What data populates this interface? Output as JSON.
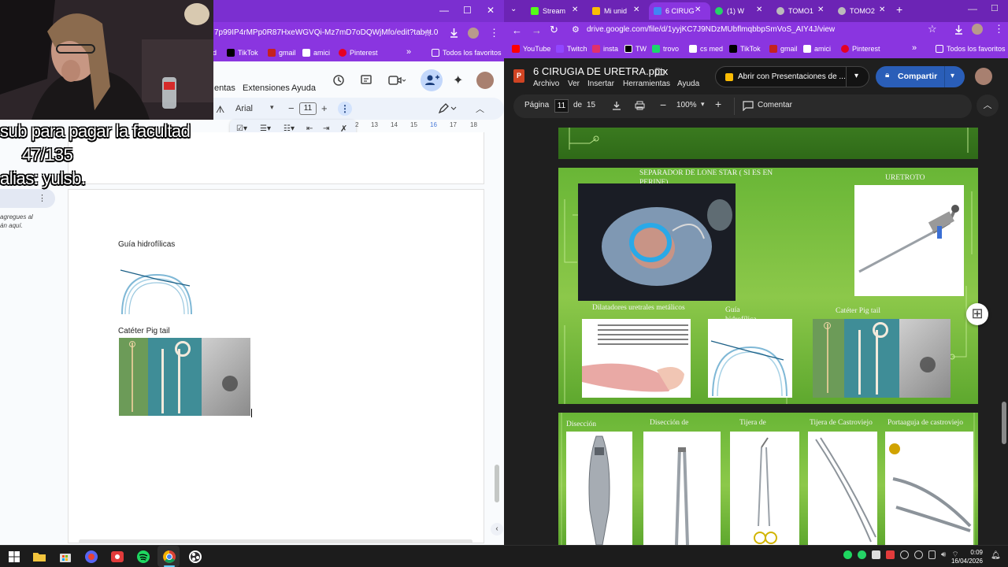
{
  "left_window": {
    "controls": {
      "minimize": "—",
      "maximize": "☐",
      "close": "✕"
    },
    "url": "7p99IP4rMPp0R87HxeWGVQi-Mz7mD7oDQWjMfo/edit?tab=t.0",
    "bookmarks": [
      {
        "label": "d",
        "color": "#ffffff"
      },
      {
        "label": "TikTok",
        "color": "#000000"
      },
      {
        "label": "gmail",
        "color": "#c5221f"
      },
      {
        "label": "amici",
        "color": "#ffffff"
      },
      {
        "label": "Pinterest",
        "color": "#e60023"
      }
    ],
    "more_bookmarks": "»",
    "all_bookmarks": "Todos los favoritos",
    "menu": {
      "item1": "entas",
      "item2": "Extensiones",
      "item3": "Ayuda"
    },
    "toolbar": {
      "font": "Arial",
      "font_size": "11",
      "minus": "−",
      "plus": "+"
    },
    "ruler": [
      "2",
      "13",
      "14",
      "15",
      "16",
      "17",
      "18"
    ],
    "outline_hint_line1": "agregues al",
    "outline_hint_line2": "án aquí.",
    "document": {
      "caption1": "Guía hidrofílicas",
      "caption2": "Catéter Pig tail"
    }
  },
  "overlay": {
    "line1": "sub para pagar la facultad",
    "line2": "47/135",
    "line3": "alias: yulsb."
  },
  "right_window": {
    "tabs": [
      {
        "label": "Stream",
        "color": "#53fc18"
      },
      {
        "label": "Mi unid",
        "color": "#fbbc04"
      },
      {
        "label": "6 CIRUG",
        "color": "#4285f4"
      },
      {
        "label": "(1) W",
        "color": "#25d366"
      },
      {
        "label": "TOMO1",
        "color": "#bbbbbb"
      },
      {
        "label": "TOMO2",
        "color": "#bbbbbb"
      }
    ],
    "new_tab": "+",
    "url": "drive.google.com/file/d/1yyjKC7J9NDzMUbflmqbbpSmVoS_AIY4J/view",
    "bookmarks": [
      {
        "label": "YouTube",
        "color": "#ff0000"
      },
      {
        "label": "Twitch",
        "color": "#9146ff"
      },
      {
        "label": "insta",
        "color": "#e1306c"
      },
      {
        "label": "TW",
        "color": "#000000"
      },
      {
        "label": "trovo",
        "color": "#1bd66c"
      },
      {
        "label": "cs med",
        "color": "#ffffff"
      },
      {
        "label": "TikTok",
        "color": "#000000"
      },
      {
        "label": "gmail",
        "color": "#c5221f"
      },
      {
        "label": "amici",
        "color": "#ffffff"
      },
      {
        "label": "Pinterest",
        "color": "#e60023"
      }
    ],
    "more_bookmarks": "»",
    "all_bookmarks": "Todos los favoritos",
    "file_name": "6 CIRUGIA DE URETRA.pptx",
    "menu": [
      "Archivo",
      "Ver",
      "Insertar",
      "Herramientas",
      "Ayuda"
    ],
    "open_with": "Abrir con Presentaciones de ...",
    "share": "Compartir",
    "toolbar": {
      "page_label": "Página",
      "page": "11",
      "of": "de",
      "total": "15",
      "zoom": "100%",
      "comment": "Comentar"
    },
    "slide_b": {
      "separador": "SEPARADOR DE LONE STAR ( SI ES EN",
      "separador2": "PERINE)",
      "uretroto": "URETROTO",
      "dilatadores": "Dilatadores uretrales metálicos",
      "guia": "Guía",
      "guia2": "hidrofílica",
      "pigtail": "Catéter Pig tail"
    },
    "slide_c": {
      "lbl1": "Disección",
      "lbl2": "Disección de",
      "lbl3": "Tijera de",
      "lbl4": "Tijera de Castroviejo",
      "lbl5": "Portaaguja de castroviejo"
    }
  },
  "taskbar": {
    "time": "0:09",
    "date": "16/04/2026"
  }
}
